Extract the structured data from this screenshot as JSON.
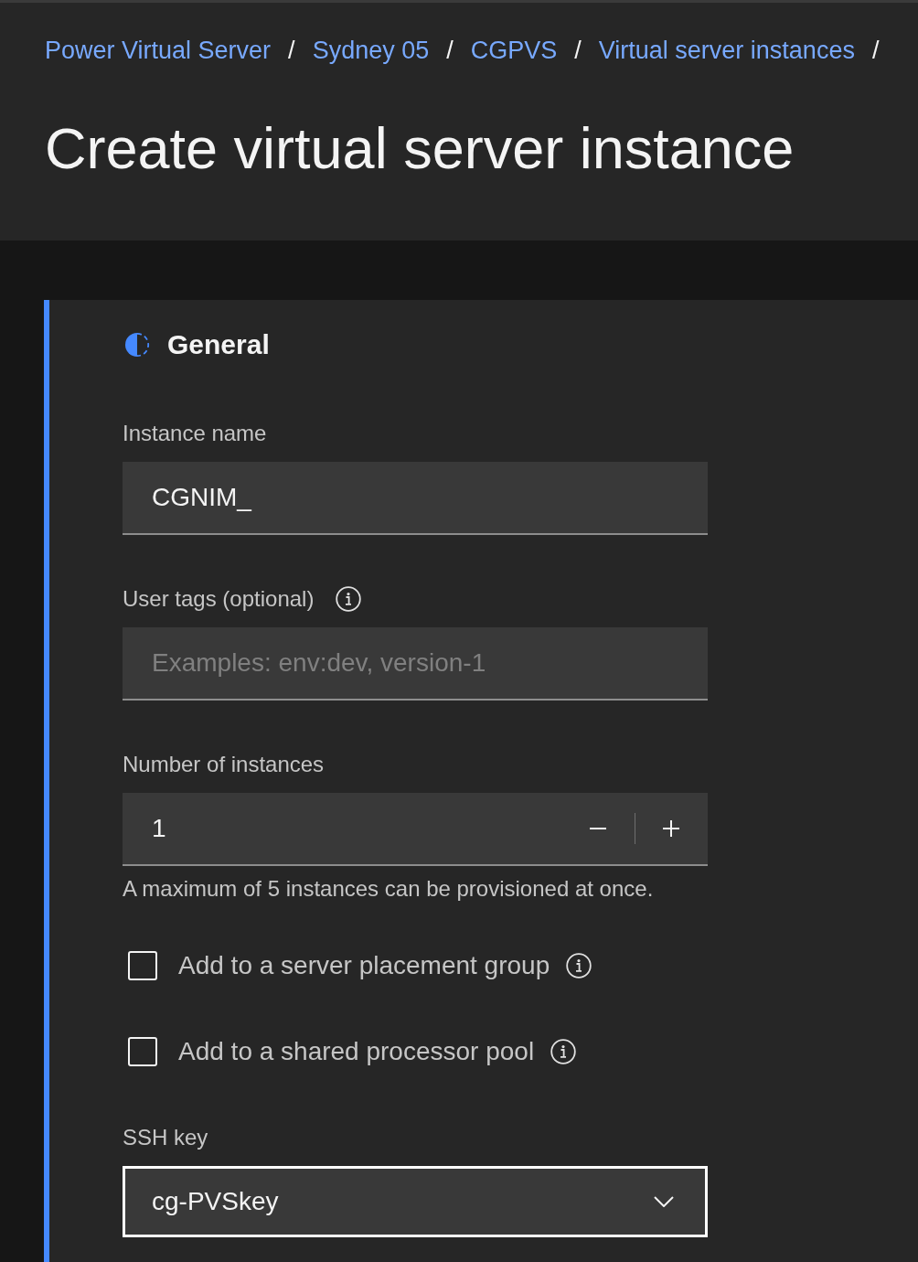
{
  "breadcrumb": [
    {
      "label": "Power Virtual Server",
      "separator": "/"
    },
    {
      "label": "Sydney 05",
      "separator": "/"
    },
    {
      "label": "CGPVS",
      "separator": "/"
    },
    {
      "label": "Virtual server instances",
      "separator": "/"
    }
  ],
  "page_title": "Create virtual server instance",
  "section": {
    "title": "General",
    "fields": [
      {
        "kind": "text",
        "label": "Instance name",
        "value": "CGNIM_",
        "info": false
      },
      {
        "kind": "text",
        "label": "User tags (optional)",
        "placeholder": "Examples: env:dev, version-1",
        "info": true
      },
      {
        "kind": "number",
        "label": "Number of instances",
        "value": "1",
        "helper": "A maximum of 5 instances can be provisioned at once.",
        "info": false
      },
      {
        "kind": "checkbox",
        "label": "Add to a server placement group",
        "checked": false,
        "info": true
      },
      {
        "kind": "checkbox",
        "label": "Add to a shared processor pool",
        "checked": false,
        "info": true
      },
      {
        "kind": "select",
        "label": "SSH key",
        "value": "cg-PVSkey",
        "focused": true,
        "info": false
      }
    ]
  }
}
